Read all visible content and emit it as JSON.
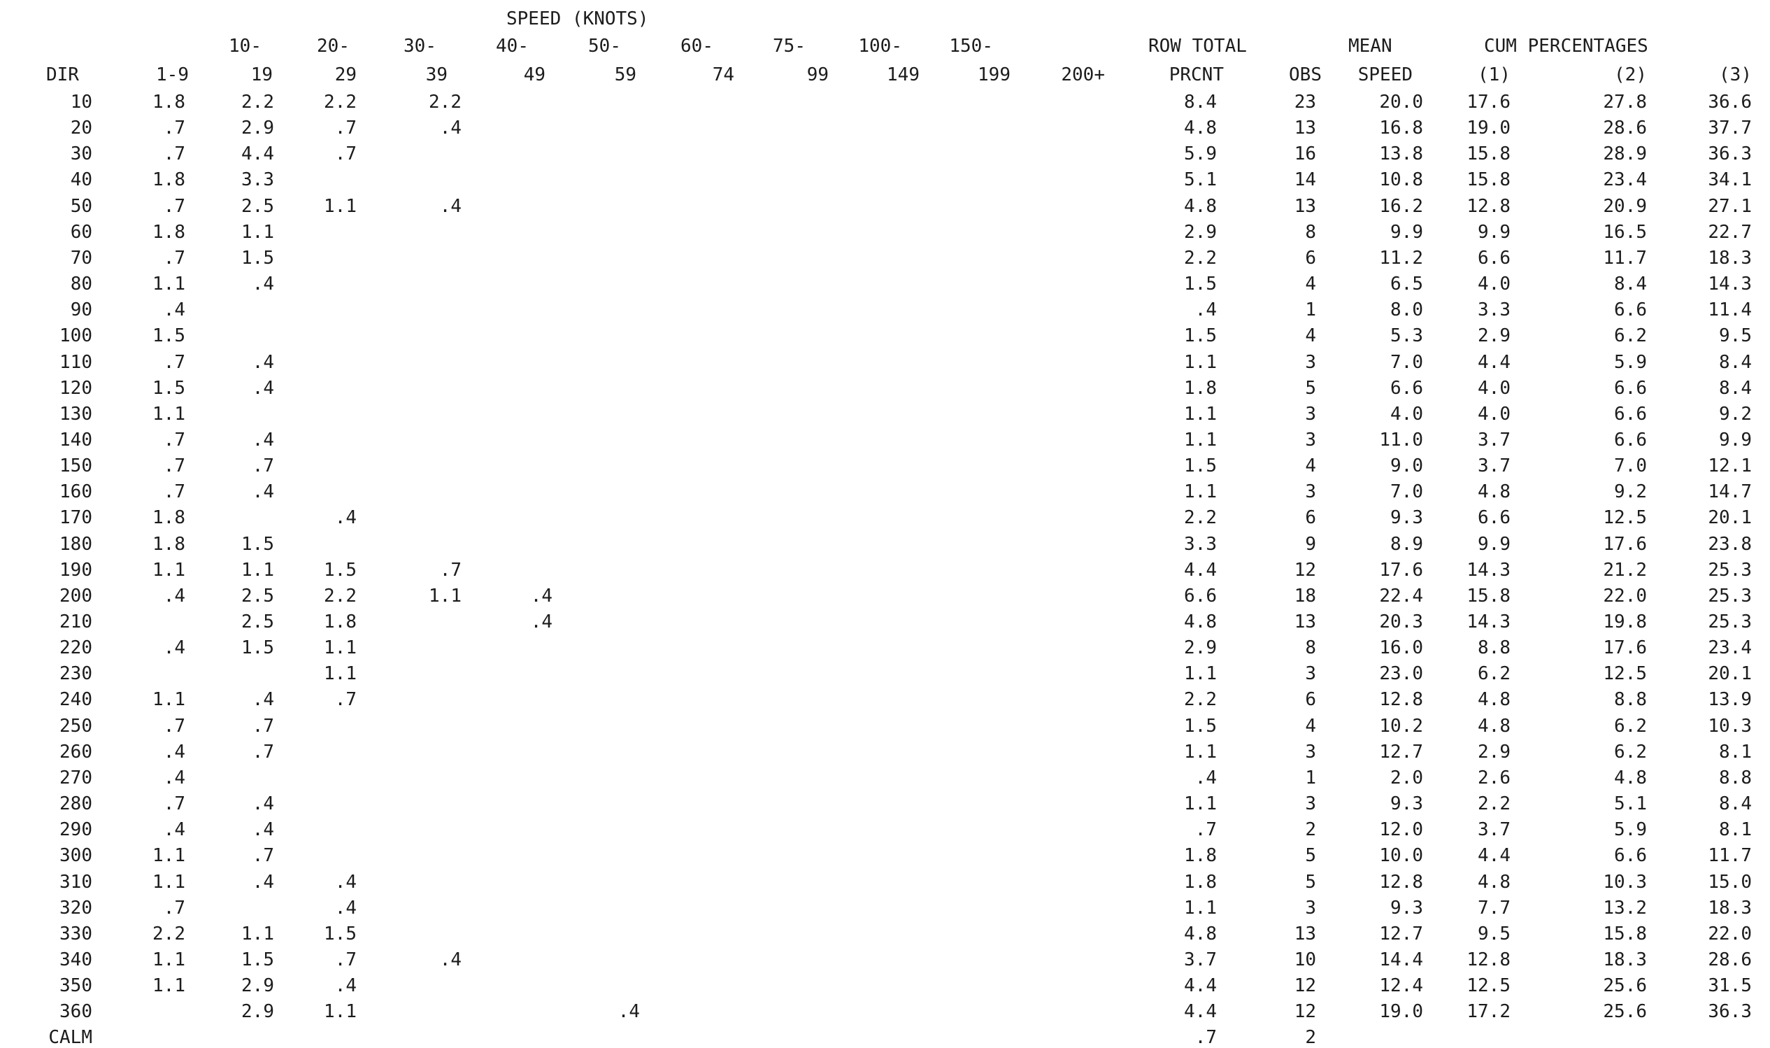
{
  "header": {
    "speed_title": "SPEED (KNOTS)",
    "speed_bands_top": [
      "10-",
      "20-",
      "30-",
      "40-",
      "50-",
      "60-",
      "75-",
      "100-",
      "150-"
    ],
    "speed_bands_bottom": [
      "1-9",
      "19",
      "29",
      "39",
      "49",
      "59",
      "74",
      "99",
      "149",
      "199",
      "200+"
    ],
    "dir_label": "DIR",
    "row_total_label": "ROW TOTAL",
    "prcnt_label": "PRCNT",
    "obs_label": "OBS",
    "mean_label": "MEAN",
    "speed_label": "SPEED",
    "cum_label": "CUM PERCENTAGES",
    "cum_cols": [
      "(1)",
      "(2)",
      "(3)"
    ]
  },
  "rows": [
    {
      "dir": "10",
      "bands": [
        "1.8",
        "2.2",
        "2.2",
        "2.2",
        "",
        "",
        "",
        "",
        "",
        "",
        ""
      ],
      "prcnt": "8.4",
      "obs": "23",
      "mean": "20.0",
      "c1": "17.6",
      "c2": "27.8",
      "c3": "36.6"
    },
    {
      "dir": "20",
      "bands": [
        ".7",
        "2.9",
        ".7",
        ".4",
        "",
        "",
        "",
        "",
        "",
        "",
        ""
      ],
      "prcnt": "4.8",
      "obs": "13",
      "mean": "16.8",
      "c1": "19.0",
      "c2": "28.6",
      "c3": "37.7"
    },
    {
      "dir": "30",
      "bands": [
        ".7",
        "4.4",
        ".7",
        "",
        "",
        "",
        "",
        "",
        "",
        "",
        ""
      ],
      "prcnt": "5.9",
      "obs": "16",
      "mean": "13.8",
      "c1": "15.8",
      "c2": "28.9",
      "c3": "36.3"
    },
    {
      "dir": "40",
      "bands": [
        "1.8",
        "3.3",
        "",
        "",
        "",
        "",
        "",
        "",
        "",
        "",
        ""
      ],
      "prcnt": "5.1",
      "obs": "14",
      "mean": "10.8",
      "c1": "15.8",
      "c2": "23.4",
      "c3": "34.1"
    },
    {
      "dir": "50",
      "bands": [
        ".7",
        "2.5",
        "1.1",
        ".4",
        "",
        "",
        "",
        "",
        "",
        "",
        ""
      ],
      "prcnt": "4.8",
      "obs": "13",
      "mean": "16.2",
      "c1": "12.8",
      "c2": "20.9",
      "c3": "27.1"
    },
    {
      "dir": "60",
      "bands": [
        "1.8",
        "1.1",
        "",
        "",
        "",
        "",
        "",
        "",
        "",
        "",
        ""
      ],
      "prcnt": "2.9",
      "obs": "8",
      "mean": "9.9",
      "c1": "9.9",
      "c2": "16.5",
      "c3": "22.7"
    },
    {
      "dir": "70",
      "bands": [
        ".7",
        "1.5",
        "",
        "",
        "",
        "",
        "",
        "",
        "",
        "",
        ""
      ],
      "prcnt": "2.2",
      "obs": "6",
      "mean": "11.2",
      "c1": "6.6",
      "c2": "11.7",
      "c3": "18.3"
    },
    {
      "dir": "80",
      "bands": [
        "1.1",
        ".4",
        "",
        "",
        "",
        "",
        "",
        "",
        "",
        "",
        ""
      ],
      "prcnt": "1.5",
      "obs": "4",
      "mean": "6.5",
      "c1": "4.0",
      "c2": "8.4",
      "c3": "14.3"
    },
    {
      "dir": "90",
      "bands": [
        ".4",
        "",
        "",
        "",
        "",
        "",
        "",
        "",
        "",
        "",
        ""
      ],
      "prcnt": ".4",
      "obs": "1",
      "mean": "8.0",
      "c1": "3.3",
      "c2": "6.6",
      "c3": "11.4"
    },
    {
      "dir": "100",
      "bands": [
        "1.5",
        "",
        "",
        "",
        "",
        "",
        "",
        "",
        "",
        "",
        ""
      ],
      "prcnt": "1.5",
      "obs": "4",
      "mean": "5.3",
      "c1": "2.9",
      "c2": "6.2",
      "c3": "9.5"
    },
    {
      "dir": "110",
      "bands": [
        ".7",
        ".4",
        "",
        "",
        "",
        "",
        "",
        "",
        "",
        "",
        ""
      ],
      "prcnt": "1.1",
      "obs": "3",
      "mean": "7.0",
      "c1": "4.4",
      "c2": "5.9",
      "c3": "8.4"
    },
    {
      "dir": "120",
      "bands": [
        "1.5",
        ".4",
        "",
        "",
        "",
        "",
        "",
        "",
        "",
        "",
        ""
      ],
      "prcnt": "1.8",
      "obs": "5",
      "mean": "6.6",
      "c1": "4.0",
      "c2": "6.6",
      "c3": "8.4"
    },
    {
      "dir": "130",
      "bands": [
        "1.1",
        "",
        "",
        "",
        "",
        "",
        "",
        "",
        "",
        "",
        ""
      ],
      "prcnt": "1.1",
      "obs": "3",
      "mean": "4.0",
      "c1": "4.0",
      "c2": "6.6",
      "c3": "9.2"
    },
    {
      "dir": "140",
      "bands": [
        ".7",
        ".4",
        "",
        "",
        "",
        "",
        "",
        "",
        "",
        "",
        ""
      ],
      "prcnt": "1.1",
      "obs": "3",
      "mean": "11.0",
      "c1": "3.7",
      "c2": "6.6",
      "c3": "9.9"
    },
    {
      "dir": "150",
      "bands": [
        ".7",
        ".7",
        "",
        "",
        "",
        "",
        "",
        "",
        "",
        "",
        ""
      ],
      "prcnt": "1.5",
      "obs": "4",
      "mean": "9.0",
      "c1": "3.7",
      "c2": "7.0",
      "c3": "12.1"
    },
    {
      "dir": "160",
      "bands": [
        ".7",
        ".4",
        "",
        "",
        "",
        "",
        "",
        "",
        "",
        "",
        ""
      ],
      "prcnt": "1.1",
      "obs": "3",
      "mean": "7.0",
      "c1": "4.8",
      "c2": "9.2",
      "c3": "14.7"
    },
    {
      "dir": "170",
      "bands": [
        "1.8",
        "",
        ".4",
        "",
        "",
        "",
        "",
        "",
        "",
        "",
        ""
      ],
      "prcnt": "2.2",
      "obs": "6",
      "mean": "9.3",
      "c1": "6.6",
      "c2": "12.5",
      "c3": "20.1"
    },
    {
      "dir": "180",
      "bands": [
        "1.8",
        "1.5",
        "",
        "",
        "",
        "",
        "",
        "",
        "",
        "",
        ""
      ],
      "prcnt": "3.3",
      "obs": "9",
      "mean": "8.9",
      "c1": "9.9",
      "c2": "17.6",
      "c3": "23.8"
    },
    {
      "dir": "190",
      "bands": [
        "1.1",
        "1.1",
        "1.5",
        ".7",
        "",
        "",
        "",
        "",
        "",
        "",
        ""
      ],
      "prcnt": "4.4",
      "obs": "12",
      "mean": "17.6",
      "c1": "14.3",
      "c2": "21.2",
      "c3": "25.3"
    },
    {
      "dir": "200",
      "bands": [
        ".4",
        "2.5",
        "2.2",
        "1.1",
        ".4",
        "",
        "",
        "",
        "",
        "",
        ""
      ],
      "prcnt": "6.6",
      "obs": "18",
      "mean": "22.4",
      "c1": "15.8",
      "c2": "22.0",
      "c3": "25.3"
    },
    {
      "dir": "210",
      "bands": [
        "",
        "2.5",
        "1.8",
        "",
        ".4",
        "",
        "",
        "",
        "",
        "",
        ""
      ],
      "prcnt": "4.8",
      "obs": "13",
      "mean": "20.3",
      "c1": "14.3",
      "c2": "19.8",
      "c3": "25.3"
    },
    {
      "dir": "220",
      "bands": [
        ".4",
        "1.5",
        "1.1",
        "",
        "",
        "",
        "",
        "",
        "",
        "",
        ""
      ],
      "prcnt": "2.9",
      "obs": "8",
      "mean": "16.0",
      "c1": "8.8",
      "c2": "17.6",
      "c3": "23.4"
    },
    {
      "dir": "230",
      "bands": [
        "",
        "",
        "1.1",
        "",
        "",
        "",
        "",
        "",
        "",
        "",
        ""
      ],
      "prcnt": "1.1",
      "obs": "3",
      "mean": "23.0",
      "c1": "6.2",
      "c2": "12.5",
      "c3": "20.1"
    },
    {
      "dir": "240",
      "bands": [
        "1.1",
        ".4",
        ".7",
        "",
        "",
        "",
        "",
        "",
        "",
        "",
        ""
      ],
      "prcnt": "2.2",
      "obs": "6",
      "mean": "12.8",
      "c1": "4.8",
      "c2": "8.8",
      "c3": "13.9"
    },
    {
      "dir": "250",
      "bands": [
        ".7",
        ".7",
        "",
        "",
        "",
        "",
        "",
        "",
        "",
        "",
        ""
      ],
      "prcnt": "1.5",
      "obs": "4",
      "mean": "10.2",
      "c1": "4.8",
      "c2": "6.2",
      "c3": "10.3"
    },
    {
      "dir": "260",
      "bands": [
        ".4",
        ".7",
        "",
        "",
        "",
        "",
        "",
        "",
        "",
        "",
        ""
      ],
      "prcnt": "1.1",
      "obs": "3",
      "mean": "12.7",
      "c1": "2.9",
      "c2": "6.2",
      "c3": "8.1"
    },
    {
      "dir": "270",
      "bands": [
        ".4",
        "",
        "",
        "",
        "",
        "",
        "",
        "",
        "",
        "",
        ""
      ],
      "prcnt": ".4",
      "obs": "1",
      "mean": "2.0",
      "c1": "2.6",
      "c2": "4.8",
      "c3": "8.8"
    },
    {
      "dir": "280",
      "bands": [
        ".7",
        ".4",
        "",
        "",
        "",
        "",
        "",
        "",
        "",
        "",
        ""
      ],
      "prcnt": "1.1",
      "obs": "3",
      "mean": "9.3",
      "c1": "2.2",
      "c2": "5.1",
      "c3": "8.4"
    },
    {
      "dir": "290",
      "bands": [
        ".4",
        ".4",
        "",
        "",
        "",
        "",
        "",
        "",
        "",
        "",
        ""
      ],
      "prcnt": ".7",
      "obs": "2",
      "mean": "12.0",
      "c1": "3.7",
      "c2": "5.9",
      "c3": "8.1"
    },
    {
      "dir": "300",
      "bands": [
        "1.1",
        ".7",
        "",
        "",
        "",
        "",
        "",
        "",
        "",
        "",
        ""
      ],
      "prcnt": "1.8",
      "obs": "5",
      "mean": "10.0",
      "c1": "4.4",
      "c2": "6.6",
      "c3": "11.7"
    },
    {
      "dir": "310",
      "bands": [
        "1.1",
        ".4",
        ".4",
        "",
        "",
        "",
        "",
        "",
        "",
        "",
        ""
      ],
      "prcnt": "1.8",
      "obs": "5",
      "mean": "12.8",
      "c1": "4.8",
      "c2": "10.3",
      "c3": "15.0"
    },
    {
      "dir": "320",
      "bands": [
        ".7",
        "",
        ".4",
        "",
        "",
        "",
        "",
        "",
        "",
        "",
        ""
      ],
      "prcnt": "1.1",
      "obs": "3",
      "mean": "9.3",
      "c1": "7.7",
      "c2": "13.2",
      "c3": "18.3"
    },
    {
      "dir": "330",
      "bands": [
        "2.2",
        "1.1",
        "1.5",
        "",
        "",
        "",
        "",
        "",
        "",
        "",
        ""
      ],
      "prcnt": "4.8",
      "obs": "13",
      "mean": "12.7",
      "c1": "9.5",
      "c2": "15.8",
      "c3": "22.0"
    },
    {
      "dir": "340",
      "bands": [
        "1.1",
        "1.5",
        ".7",
        ".4",
        "",
        "",
        "",
        "",
        "",
        "",
        ""
      ],
      "prcnt": "3.7",
      "obs": "10",
      "mean": "14.4",
      "c1": "12.8",
      "c2": "18.3",
      "c3": "28.6"
    },
    {
      "dir": "350",
      "bands": [
        "1.1",
        "2.9",
        ".4",
        "",
        "",
        "",
        "",
        "",
        "",
        "",
        ""
      ],
      "prcnt": "4.4",
      "obs": "12",
      "mean": "12.4",
      "c1": "12.5",
      "c2": "25.6",
      "c3": "31.5"
    },
    {
      "dir": "360",
      "bands": [
        "",
        "2.9",
        "1.1",
        "",
        "",
        ".4",
        "",
        "",
        "",
        "",
        ""
      ],
      "prcnt": "4.4",
      "obs": "12",
      "mean": "19.0",
      "c1": "17.2",
      "c2": "25.6",
      "c3": "36.3"
    },
    {
      "dir": "CALM",
      "bands": [
        "",
        "",
        "",
        "",
        "",
        "",
        "",
        "",
        "",
        "",
        ""
      ],
      "prcnt": ".7",
      "obs": "2",
      "mean": "",
      "c1": "",
      "c2": "",
      "c3": ""
    }
  ]
}
